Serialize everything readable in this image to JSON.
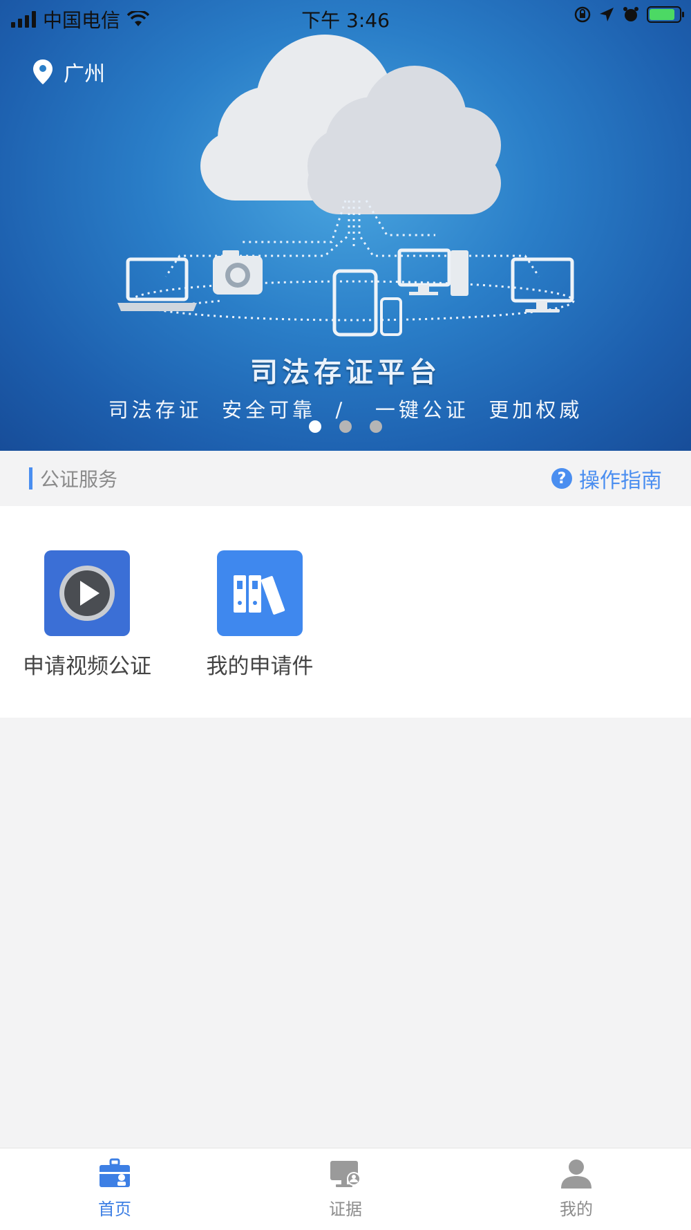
{
  "status_bar": {
    "carrier": "中国电信",
    "time": "下午 3:46"
  },
  "banner": {
    "location": "广州",
    "title": "司法存证平台",
    "slogan": "司法存证  安全可靠  /   一键公证  更加权威",
    "slide_count": 3,
    "active_slide": 1
  },
  "section": {
    "title": "公证服务",
    "guide_label": "操作指南"
  },
  "services": [
    {
      "label": "申请视频公证",
      "icon": "video-play-icon",
      "color": "#3b6fd6"
    },
    {
      "label": "我的申请件",
      "icon": "binders-icon",
      "color": "#3f88ee"
    }
  ],
  "tabs": [
    {
      "label": "首页",
      "icon": "home-briefcase-icon",
      "active": true
    },
    {
      "label": "证据",
      "icon": "evidence-monitor-icon",
      "active": false
    },
    {
      "label": "我的",
      "icon": "user-icon",
      "active": false
    }
  ],
  "colors": {
    "accent": "#4a8ef0",
    "tab_active": "#3d7fe4"
  }
}
